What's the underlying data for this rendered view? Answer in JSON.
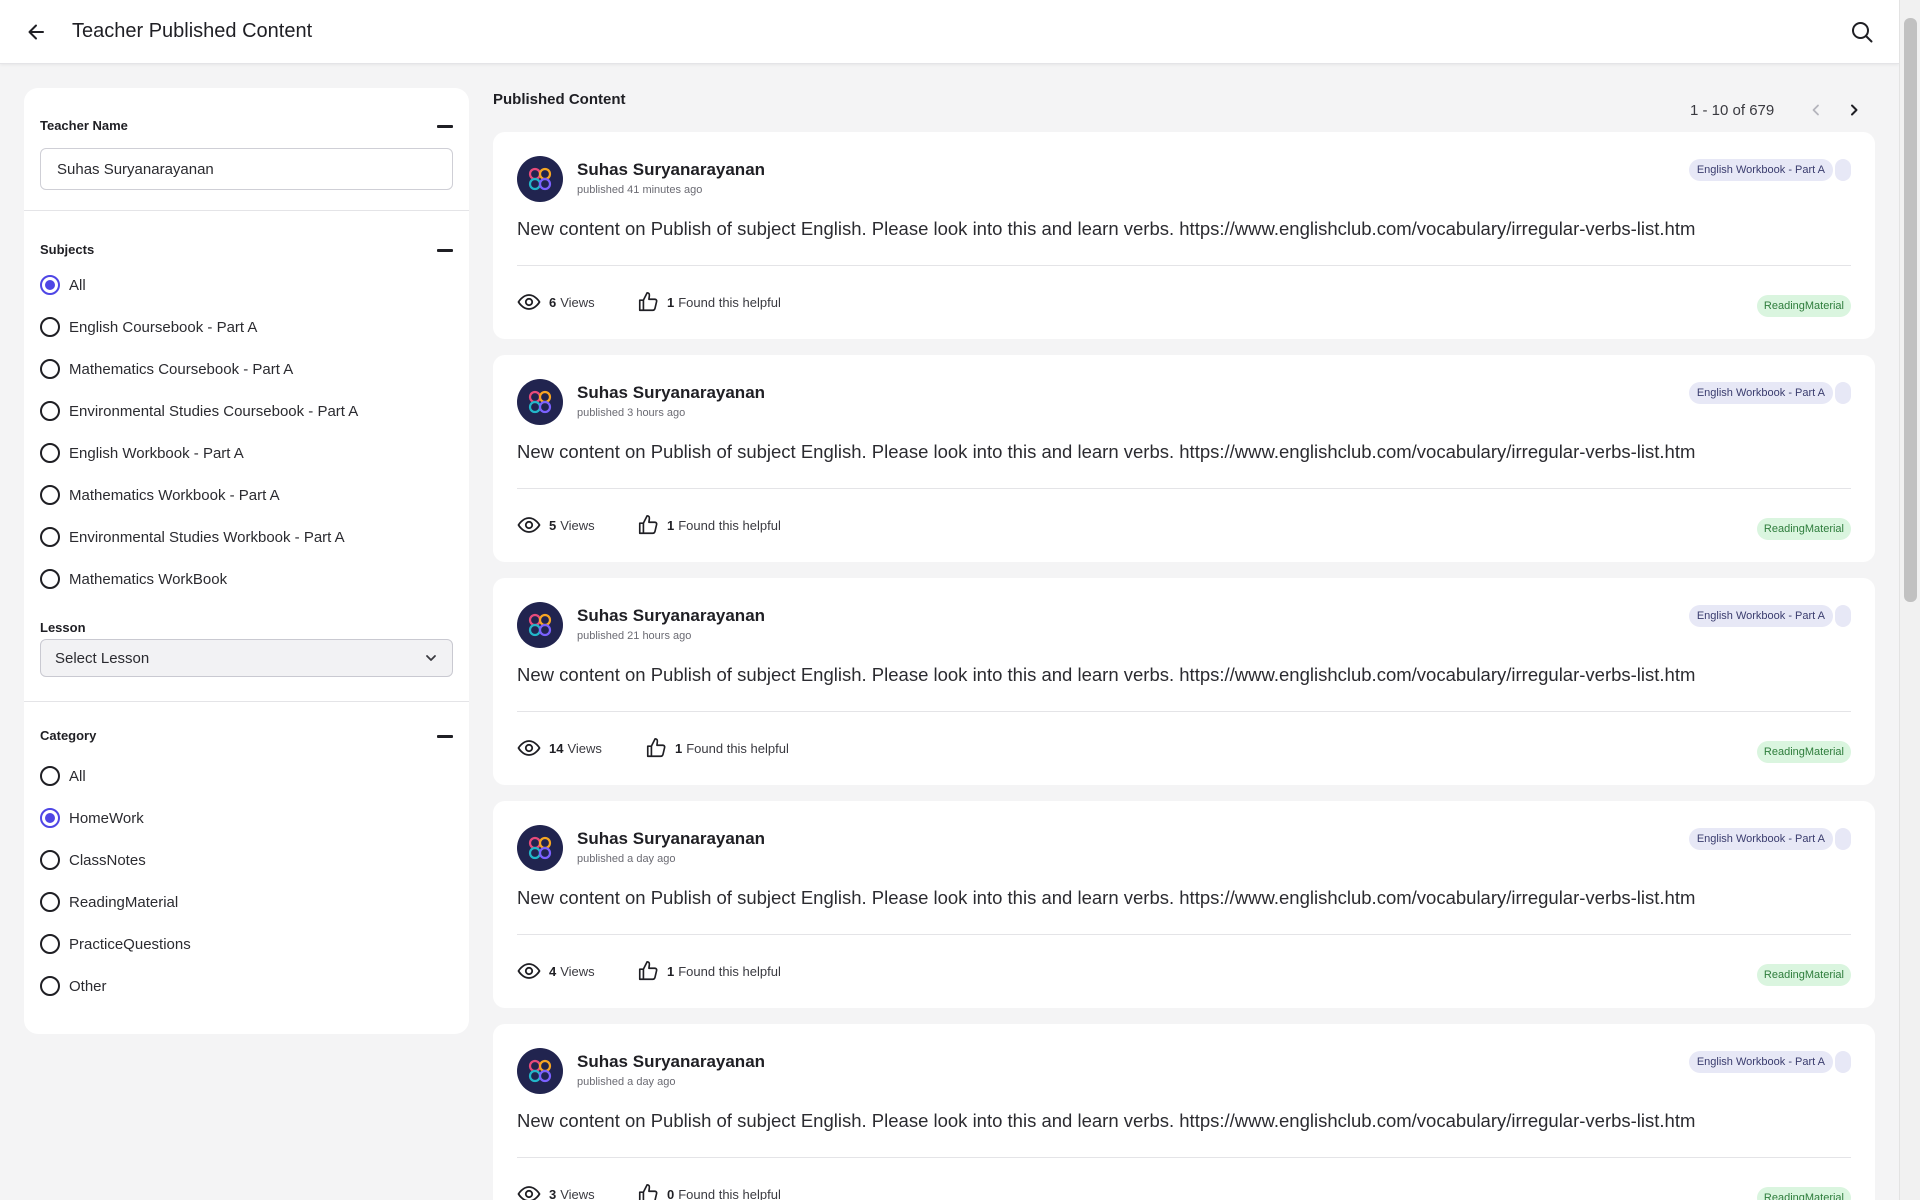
{
  "header": {
    "title": "Teacher Published Content"
  },
  "filters": {
    "teacher": {
      "label": "Teacher Name",
      "value": "Suhas Suryanarayanan"
    },
    "subjects": {
      "label": "Subjects",
      "selected": "All",
      "options": [
        "All",
        "English Coursebook - Part A",
        "Mathematics Coursebook - Part A",
        "Environmental Studies Coursebook - Part A",
        "English Workbook - Part A",
        "Mathematics Workbook - Part A",
        "Environmental Studies Workbook - Part A",
        "Mathematics WorkBook"
      ]
    },
    "lesson": {
      "label": "Lesson",
      "value": "Select Lesson"
    },
    "category": {
      "label": "Category",
      "selected": "HomeWork",
      "options": [
        "All",
        "HomeWork",
        "ClassNotes",
        "ReadingMaterial",
        "PracticeQuestions",
        "Other"
      ]
    }
  },
  "content": {
    "title": "Published Content",
    "pagination": "1 - 10 of 679",
    "views_suffix": "Views",
    "helpful_suffix": "Found this helpful",
    "avatar_colors": [
      "#21244f",
      "#e84b7a",
      "#f6a623",
      "#22b6c9",
      "#7b61ff"
    ],
    "posts": [
      {
        "author": "Suhas Suryanarayanan",
        "time": "published 41 minutes ago",
        "subject": "English Workbook - Part A",
        "text": "New content on Publish of subject English. Please look into this and learn verbs. https://www.englishclub.com/vocabulary/irregular-verbs-list.htm",
        "views": "6",
        "helpful": "1",
        "category": "ReadingMaterial"
      },
      {
        "author": "Suhas Suryanarayanan",
        "time": "published 3 hours ago",
        "subject": "English Workbook - Part A",
        "text": "New content on Publish of subject English. Please look into this and learn verbs. https://www.englishclub.com/vocabulary/irregular-verbs-list.htm",
        "views": "5",
        "helpful": "1",
        "category": "ReadingMaterial"
      },
      {
        "author": "Suhas Suryanarayanan",
        "time": "published 21 hours ago",
        "subject": "English Workbook - Part A",
        "text": "New content on Publish of subject English. Please look into this and learn verbs. https://www.englishclub.com/vocabulary/irregular-verbs-list.htm",
        "views": "14",
        "helpful": "1",
        "category": "ReadingMaterial"
      },
      {
        "author": "Suhas Suryanarayanan",
        "time": "published a day ago",
        "subject": "English Workbook - Part A",
        "text": "New content on Publish of subject English. Please look into this and learn verbs. https://www.englishclub.com/vocabulary/irregular-verbs-list.htm",
        "views": "4",
        "helpful": "1",
        "category": "ReadingMaterial"
      },
      {
        "author": "Suhas Suryanarayanan",
        "time": "published a day ago",
        "subject": "English Workbook - Part A",
        "text": "New content on Publish of subject English. Please look into this and learn verbs. https://www.englishclub.com/vocabulary/irregular-verbs-list.htm",
        "views": "3",
        "helpful": "0",
        "category": "ReadingMaterial"
      }
    ]
  }
}
